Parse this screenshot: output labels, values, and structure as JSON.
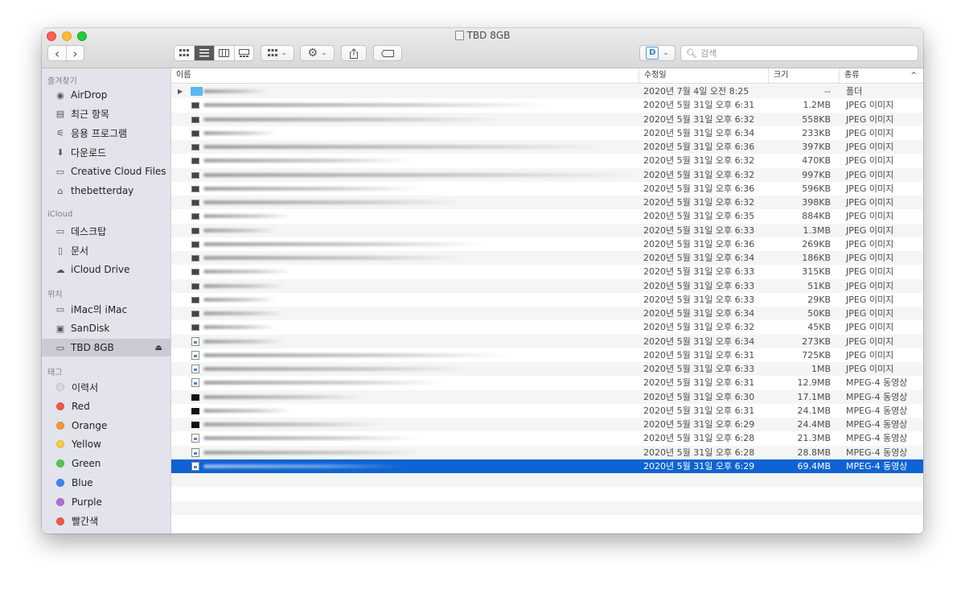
{
  "window": {
    "title": "TBD 8GB"
  },
  "toolbar": {
    "search_placeholder": "검색",
    "nav_back": "‹",
    "nav_forward": "›"
  },
  "sidebar": {
    "favorites_header": "즐겨찾기",
    "favorites": [
      {
        "label": "AirDrop",
        "icon": "airdrop-icon"
      },
      {
        "label": "최근 항목",
        "icon": "recents-icon"
      },
      {
        "label": "응용 프로그램",
        "icon": "applications-icon"
      },
      {
        "label": "다운로드",
        "icon": "downloads-icon"
      },
      {
        "label": "Creative Cloud Files",
        "icon": "folder-icon"
      },
      {
        "label": "thebetterday",
        "icon": "home-icon"
      }
    ],
    "icloud_header": "iCloud",
    "icloud": [
      {
        "label": "데스크탑",
        "icon": "desktop-icon"
      },
      {
        "label": "문서",
        "icon": "documents-icon"
      },
      {
        "label": "iCloud Drive",
        "icon": "cloud-icon"
      }
    ],
    "locations_header": "위치",
    "locations": [
      {
        "label": "iMac의 iMac",
        "icon": "computer-icon"
      },
      {
        "label": "SanDisk",
        "icon": "disk-icon"
      },
      {
        "label": "TBD 8GB",
        "icon": "drive-icon",
        "eject": "⏏"
      }
    ],
    "tags_header": "태그",
    "tags": [
      {
        "label": "이력서",
        "color": "#d8d8de"
      },
      {
        "label": "Red",
        "color": "#f2554f"
      },
      {
        "label": "Orange",
        "color": "#f7953a"
      },
      {
        "label": "Yellow",
        "color": "#f8cc46"
      },
      {
        "label": "Green",
        "color": "#52c94d"
      },
      {
        "label": "Blue",
        "color": "#3c86f3"
      },
      {
        "label": "Purple",
        "color": "#b66bd4"
      },
      {
        "label": "빨간색",
        "color": "#f2554f"
      }
    ]
  },
  "columns": {
    "name": "이름",
    "date": "수정일",
    "size": "크기",
    "kind": "종류"
  },
  "files": [
    {
      "icon": "folder",
      "date": "2020년 7월 4일 오전 8:25",
      "size": "--",
      "kind": "폴더",
      "w": 80,
      "disclosure": "▶"
    },
    {
      "icon": "jpg",
      "date": "2020년 5월 31일 오후 6:31",
      "size": "1.2MB",
      "kind": "JPEG 이미지",
      "w": 430
    },
    {
      "icon": "jpg",
      "date": "2020년 5월 31일 오후 6:32",
      "size": "558KB",
      "kind": "JPEG 이미지",
      "w": 370
    },
    {
      "icon": "jpg",
      "date": "2020년 5월 31일 오후 6:34",
      "size": "233KB",
      "kind": "JPEG 이미지",
      "w": 90
    },
    {
      "icon": "jpg",
      "date": "2020년 5월 31일 오후 6:36",
      "size": "397KB",
      "kind": "JPEG 이미지",
      "w": 500
    },
    {
      "icon": "jpg",
      "date": "2020년 5월 31일 오후 6:32",
      "size": "470KB",
      "kind": "JPEG 이미지",
      "w": 260
    },
    {
      "icon": "jpg",
      "date": "2020년 5월 31일 오후 6:32",
      "size": "997KB",
      "kind": "JPEG 이미지",
      "w": 540
    },
    {
      "icon": "jpg",
      "date": "2020년 5월 31일 오후 6:36",
      "size": "596KB",
      "kind": "JPEG 이미지",
      "w": 270
    },
    {
      "icon": "jpg",
      "date": "2020년 5월 31일 오후 6:32",
      "size": "398KB",
      "kind": "JPEG 이미지",
      "w": 320
    },
    {
      "icon": "jpg",
      "date": "2020년 5월 31일 오후 6:35",
      "size": "884KB",
      "kind": "JPEG 이미지",
      "w": 110
    },
    {
      "icon": "jpg",
      "date": "2020년 5월 31일 오후 6:33",
      "size": "1.3MB",
      "kind": "JPEG 이미지",
      "w": 90
    },
    {
      "icon": "jpg",
      "date": "2020년 5월 31일 오후 6:36",
      "size": "269KB",
      "kind": "JPEG 이미지",
      "w": 350
    },
    {
      "icon": "jpg",
      "date": "2020년 5월 31일 오후 6:34",
      "size": "186KB",
      "kind": "JPEG 이미지",
      "w": 320
    },
    {
      "icon": "jpg",
      "date": "2020년 5월 31일 오후 6:33",
      "size": "315KB",
      "kind": "JPEG 이미지",
      "w": 110
    },
    {
      "icon": "jpg",
      "date": "2020년 5월 31일 오후 6:33",
      "size": "51KB",
      "kind": "JPEG 이미지",
      "w": 100
    },
    {
      "icon": "jpg",
      "date": "2020년 5월 31일 오후 6:33",
      "size": "29KB",
      "kind": "JPEG 이미지",
      "w": 90
    },
    {
      "icon": "jpg",
      "date": "2020년 5월 31일 오후 6:34",
      "size": "50KB",
      "kind": "JPEG 이미지",
      "w": 100
    },
    {
      "icon": "jpg",
      "date": "2020년 5월 31일 오후 6:32",
      "size": "45KB",
      "kind": "JPEG 이미지",
      "w": 90
    },
    {
      "icon": "doc",
      "date": "2020년 5월 31일 오후 6:34",
      "size": "273KB",
      "kind": "JPEG 이미지",
      "w": 100
    },
    {
      "icon": "doc",
      "date": "2020년 5월 31일 오후 6:31",
      "size": "725KB",
      "kind": "JPEG 이미지",
      "w": 380
    },
    {
      "icon": "doc",
      "date": "2020년 5월 31일 오후 6:33",
      "size": "1MB",
      "kind": "JPEG 이미지",
      "w": 330
    },
    {
      "icon": "doc",
      "date": "2020년 5월 31일 오후 6:31",
      "size": "12.9MB",
      "kind": "MPEG-4 동영상",
      "w": 300
    },
    {
      "icon": "vid",
      "date": "2020년 5월 31일 오후 6:30",
      "size": "17.1MB",
      "kind": "MPEG-4 동영상",
      "w": 200
    },
    {
      "icon": "vid",
      "date": "2020년 5월 31일 오후 6:31",
      "size": "24.1MB",
      "kind": "MPEG-4 동영상",
      "w": 110
    },
    {
      "icon": "vid",
      "date": "2020년 5월 31일 오후 6:29",
      "size": "24.4MB",
      "kind": "MPEG-4 동영상",
      "w": 220
    },
    {
      "icon": "doc",
      "date": "2020년 5월 31일 오후 6:28",
      "size": "21.3MB",
      "kind": "MPEG-4 동영상",
      "w": 270
    },
    {
      "icon": "doc",
      "date": "2020년 5월 31일 오후 6:28",
      "size": "28.8MB",
      "kind": "MPEG-4 동영상",
      "w": 270
    },
    {
      "icon": "doc",
      "date": "2020년 5월 31일 오후 6:29",
      "size": "69.4MB",
      "kind": "MPEG-4 동영상",
      "w": 250,
      "selected": true
    }
  ]
}
